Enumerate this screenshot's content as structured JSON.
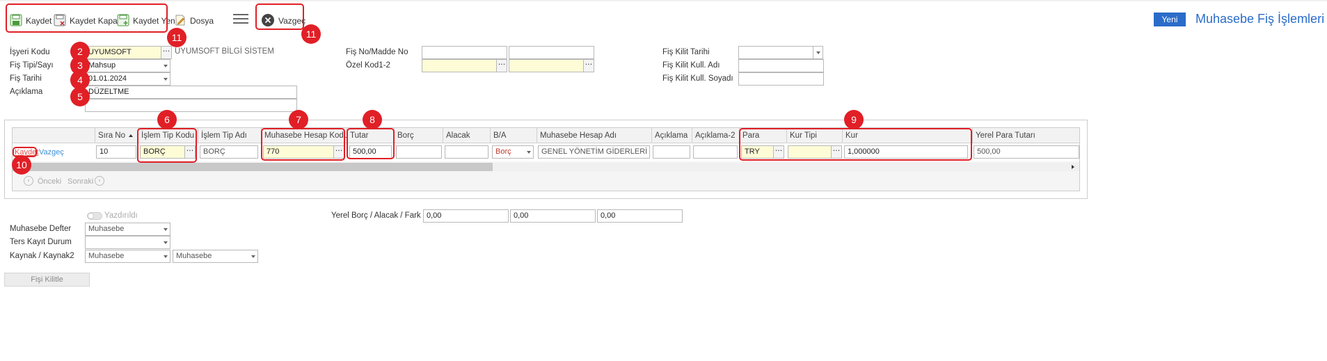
{
  "toolbar": {
    "save_label": "Kaydet",
    "save_close_label": "Kaydet Kapat",
    "save_new_label": "Kaydet Yeni",
    "file_label": "Dosya",
    "cancel_label": "Vazgeç",
    "new_label": "Yeni",
    "page_title": "Muhasebe Fiş İşlemleri"
  },
  "badges": {
    "b11a": "11",
    "b11b": "11",
    "b2": "2",
    "b3": "3",
    "b4": "4",
    "b5": "5",
    "b6": "6",
    "b7": "7",
    "b8": "8",
    "b9": "9",
    "b10": "10"
  },
  "header_form": {
    "isyeri_label": "İşyeri Kodu",
    "isyeri_value": "UYUMSOFT",
    "isyeri_desc": "UYUMSOFT BİLGİ SİSTEM",
    "fis_tipi_label": "Fiş Tipi/Sayı",
    "fis_tipi_value": "Mahsup",
    "fis_tarihi_label": "Fiş Tarihi",
    "fis_tarihi_value": "01.01.2024",
    "aciklama_label": "Açıklama",
    "aciklama_value": "DÜZELTME",
    "aciklama2_value": "",
    "fis_no_label": "Fiş No/Madde No",
    "fis_no_value": "",
    "madde_no_value": "",
    "ozel_kod_label": "Özel Kod1-2",
    "ozel_kod1_value": "",
    "ozel_kod2_value": "",
    "kilit_tarihi_label": "Fiş Kilit Tarihi",
    "kilit_tarihi_value": "",
    "kilit_adi_label": "Fiş Kilit Kull. Adı",
    "kilit_adi_value": "",
    "kilit_soyadi_label": "Fiş Kilit Kull. Soyadı",
    "kilit_soyadi_value": ""
  },
  "grid": {
    "columns": [
      "",
      "Sıra No",
      "İşlem Tip Kodu",
      "İşlem Tip Adı",
      "Muhasebe Hesap Kodu",
      "Tutar",
      "Borç",
      "Alacak",
      "B/A",
      "Muhasebe Hesap Adı",
      "Açıklama",
      "Açıklama-2",
      "Para",
      "Kur Tipi",
      "Kur",
      "Yerel Para Tutarı"
    ],
    "sort_indicator": "ascending",
    "row": {
      "save_link": "Kaydet",
      "cancel_link": "Vazgeç",
      "sira_no": "10",
      "islem_tip_kodu": "BORÇ",
      "islem_tip_adi": "BORÇ",
      "hesap_kodu": "770",
      "tutar": "500,00",
      "borc": "",
      "alacak": "",
      "ba": "Borç",
      "hesap_adi": "GENEL YÖNETİM GİDERLERİ",
      "aciklama": "",
      "aciklama2": "",
      "para": "TRY",
      "kur_tipi": "",
      "kur": "1,000000",
      "yerel_tutar": "500,00"
    },
    "pager_prev": "Önceki",
    "pager_next": "Sonraki"
  },
  "footer_form": {
    "yazdirildi_label": "Yazdırıldı",
    "defter_label": "Muhasebe Defter",
    "defter_value": "Muhasebe",
    "ters_kayit_label": "Ters Kayıt Durum",
    "ters_kayit_value": "",
    "kaynak_label": "Kaynak / Kaynak2",
    "kaynak_value": "Muhasebe",
    "kaynak2_value": "Muhasebe",
    "yerel_label": "Yerel Borç / Alacak / Fark",
    "yerel_borc": "0,00",
    "yerel_alacak": "0,00",
    "yerel_fark": "0,00",
    "kilitle_label": "Fişi Kilitle"
  },
  "colors": {
    "accent": "#2a6cc9",
    "highlight": "#e11f26",
    "input_yellow": "#fdfcd7"
  }
}
